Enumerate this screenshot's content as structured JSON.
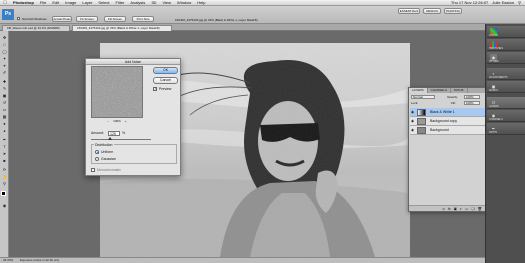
{
  "menubar": {
    "app": "Photoshop",
    "items": [
      "File",
      "Edit",
      "Image",
      "Layer",
      "Select",
      "Filter",
      "Analysis",
      "3D",
      "View",
      "Window",
      "Help"
    ],
    "clock": "Thu 17 Nov 12:26:07",
    "user": "Julie Easton"
  },
  "options_bar": {
    "mode_label": "Scroll All Windows",
    "buttons": [
      "Actual Pixels",
      "Fit Screen",
      "Fill Screen",
      "Print Size"
    ],
    "workspace": [
      "ESSENTIALS",
      "DESIGN",
      "PAINTING"
    ]
  },
  "document_tabs": [
    "KB_Waves Girl.psd @ 33.3% (RGB/8#)",
    "150406_3475403.jpg @ 33% (Black & White 1, Layer Mask/8)"
  ],
  "window_title": "150406_3475403.jpg @ 33% (Black & White 1, Layer Mask/8)",
  "status": {
    "zoom": "33.33%",
    "info": "Exposure works in 32-bit only"
  },
  "add_noise": {
    "title": "Add Noise",
    "ok": "OK",
    "cancel": "Cancel",
    "preview_label": "Preview",
    "preview_checked": true,
    "zoom": "100%",
    "zoom_out": "−",
    "zoom_in": "+",
    "amount_label": "Amount:",
    "amount_value": "125",
    "amount_unit": "%",
    "amount_fraction": 0.3125,
    "distribution_label": "Distribution",
    "uniform": "Uniform",
    "gaussian": "Gaussian",
    "selected_distribution": "Uniform",
    "monochromatic": "Monochromatic"
  },
  "layers_panel": {
    "tabs": [
      "LAYERS",
      "CHANNELS",
      "PATHS"
    ],
    "blend_mode": "Normal",
    "opacity_label": "Opacity:",
    "opacity": "100%",
    "fill_label": "Fill:",
    "fill": "100%",
    "lock_label": "Lock:",
    "layers": [
      {
        "name": "Black & White 1",
        "selected": true
      },
      {
        "name": "Background copy",
        "selected": false
      },
      {
        "name": "Background",
        "selected": false
      }
    ]
  },
  "right_panels": [
    {
      "icon": "color-icon",
      "label": "COLOR"
    },
    {
      "icon": "swatches-icon",
      "label": "SWATCHES"
    },
    {
      "icon": "styles-icon",
      "label": "STYLES"
    },
    {
      "icon": "adjustments-icon",
      "label": "ADJUSTMENTS"
    },
    {
      "icon": "masks-icon",
      "label": "MASKS"
    },
    {
      "icon": "layers-icon",
      "label": "LAYERS"
    },
    {
      "icon": "channels-icon",
      "label": "CHANNELS"
    },
    {
      "icon": "paths-icon",
      "label": "PATHS"
    }
  ],
  "colors": {
    "accent": "#2a6fcf",
    "selected_layer": "#a8c8ee",
    "panel_bg": "#4f4f4f"
  }
}
